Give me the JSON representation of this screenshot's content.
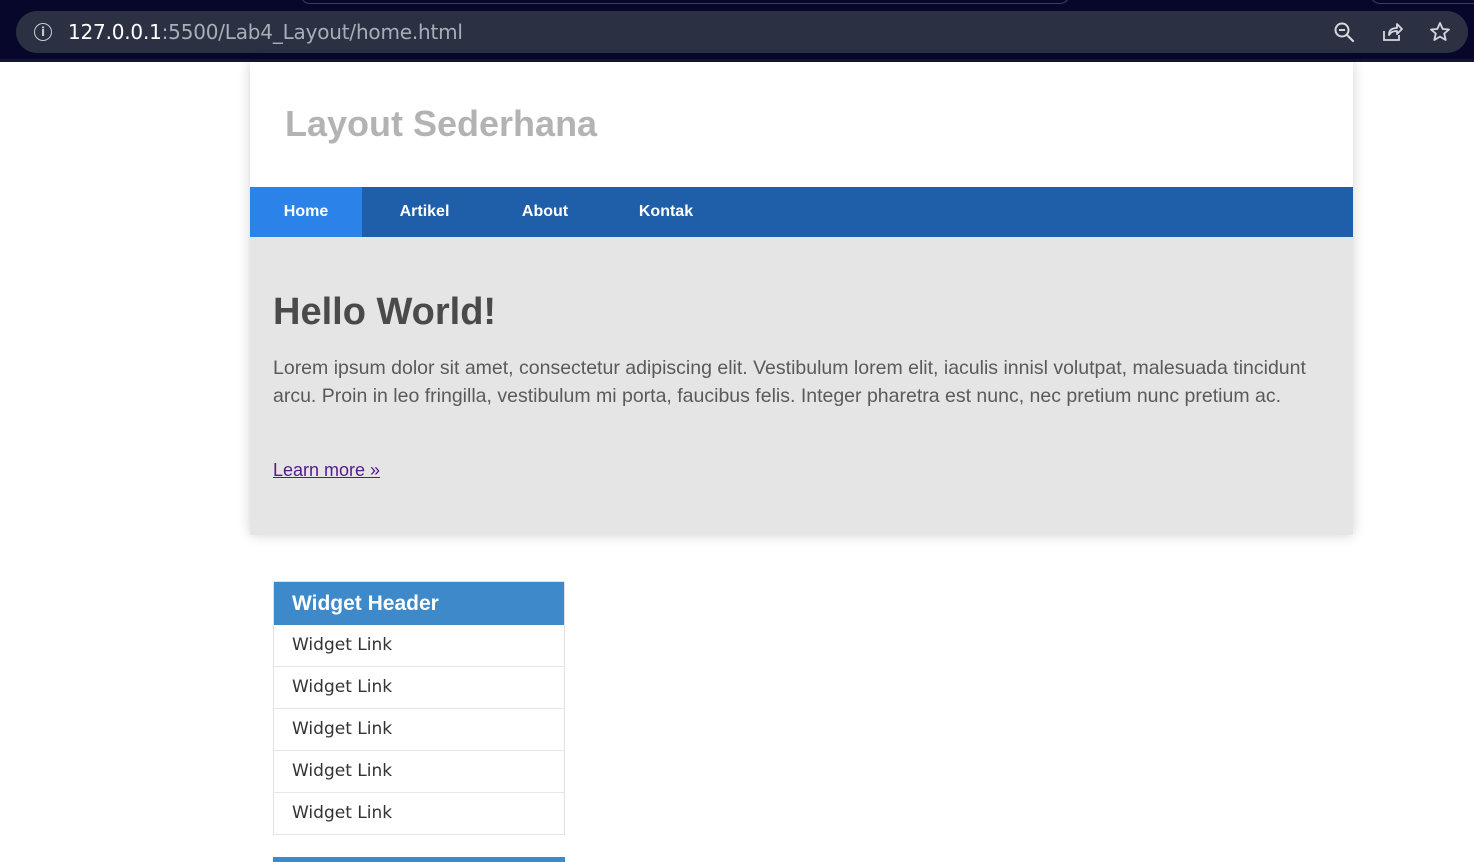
{
  "browser": {
    "url_host": "127.0.0.1",
    "url_path": ":5500/Lab4_Layout/home.html",
    "icons": [
      "info-icon",
      "zoom-icon",
      "share-icon",
      "bookmark-star-icon"
    ]
  },
  "site": {
    "title": "Layout Sederhana"
  },
  "nav": {
    "items": [
      {
        "label": "Home",
        "active": true
      },
      {
        "label": "Artikel",
        "active": false
      },
      {
        "label": "About",
        "active": false
      },
      {
        "label": "Kontak",
        "active": false
      }
    ]
  },
  "hero": {
    "title": "Hello World!",
    "text": "Lorem ipsum dolor sit amet, consectetur adipiscing elit. Vestibulum lorem elit, iaculis innisl volutpat, malesuada tincidunt arcu. Proin in leo fringilla, vestibulum mi porta, faucibus felis. Integer pharetra est nunc, nec pretium nunc pretium ac.",
    "link": "Learn more »"
  },
  "widget": {
    "header": "Widget Header",
    "links": [
      "Widget Link",
      "Widget Link",
      "Widget Link",
      "Widget Link",
      "Widget Link"
    ]
  },
  "colors": {
    "nav_bg": "#1f5faa",
    "nav_active": "#2b83ea",
    "hero_bg": "#e5e5e5",
    "widget_header": "#3d89c9"
  }
}
